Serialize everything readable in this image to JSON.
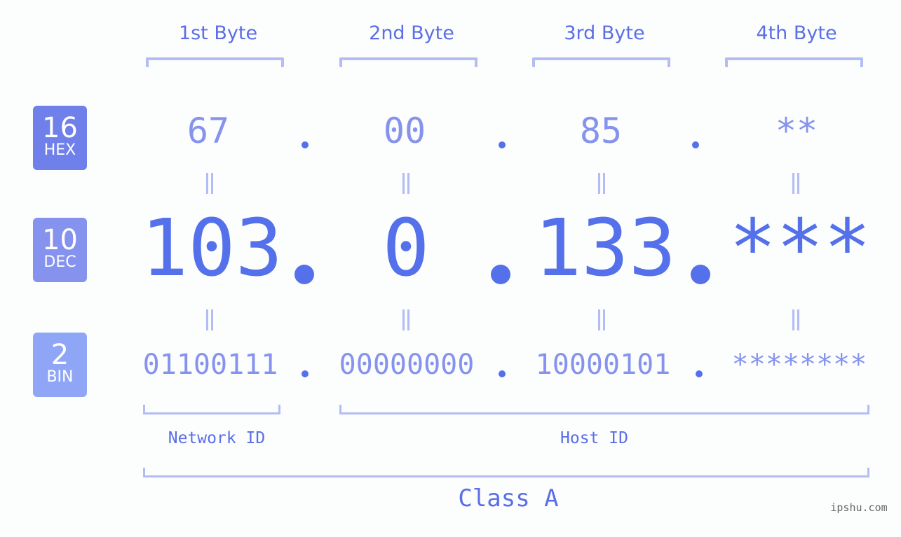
{
  "byte_headers": [
    "1st Byte",
    "2nd Byte",
    "3rd Byte",
    "4th Byte"
  ],
  "badges": [
    {
      "number": "16",
      "label": "HEX",
      "color": "#6f80ea"
    },
    {
      "number": "10",
      "label": "DEC",
      "color": "#8593ef"
    },
    {
      "number": "2",
      "label": "BIN",
      "color": "#8fa6f6"
    }
  ],
  "hex": [
    "67",
    "00",
    "85",
    "**"
  ],
  "dec": [
    "103",
    "0",
    "133",
    "***"
  ],
  "bin": [
    "01100111",
    "00000000",
    "10000101",
    "********"
  ],
  "network_label": "Network ID",
  "host_label": "Host ID",
  "class_label": "Class A",
  "watermark": "ipshu.com",
  "colors": {
    "accent": "#5470ea",
    "light": "#8593ee",
    "bracket": "#b3bcf5"
  }
}
